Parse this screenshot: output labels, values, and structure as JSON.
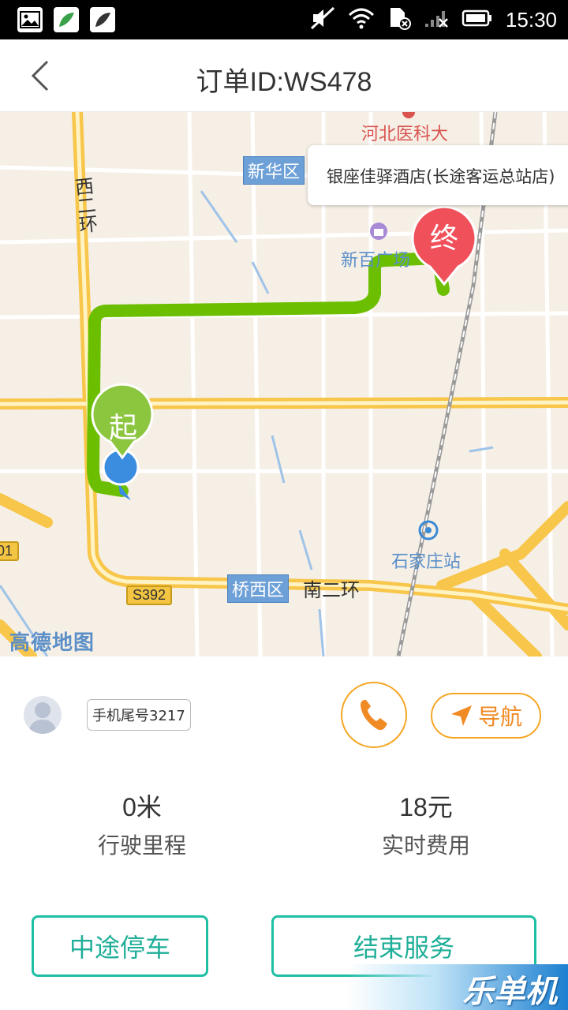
{
  "status_bar": {
    "time": "15:30",
    "icons": [
      "gallery-icon",
      "app-icon",
      "app-icon",
      "mute-icon",
      "wifi-icon",
      "sim-icon",
      "signal-icon",
      "battery-icon"
    ]
  },
  "header": {
    "title": "订单ID:WS478"
  },
  "map": {
    "poi_top": "河北医科大",
    "district_xinhua": "新华区",
    "road_xierhuan": "西二环",
    "poi_xinbaiguangchang": "新百广场",
    "callout": "银座佳驿酒店(长途客运总站店)",
    "end_marker": "终",
    "start_marker": "起",
    "station": "石家庄站",
    "district_qiaoxi": "桥西区",
    "road_nanerhuan": "南二环",
    "route_s392": "S392",
    "route_left_edge": "01",
    "provider_logo": "高德地图",
    "route_color": "#6cbf00",
    "end_marker_color": "#f0505a",
    "start_marker_color": "#8cc63f"
  },
  "driver": {
    "phone_tail": "手机尾号3217"
  },
  "actions": {
    "navigate_label": "导航",
    "stop_midway_label": "中途停车",
    "end_service_label": "结束服务"
  },
  "stats": {
    "distance_value": "0米",
    "distance_label": "行驶里程",
    "fare_value": "18元",
    "fare_label": "实时费用"
  },
  "watermark": {
    "text": "乐单机"
  },
  "accent_color": "#1fbfa4",
  "orange_color": "#f5a623"
}
